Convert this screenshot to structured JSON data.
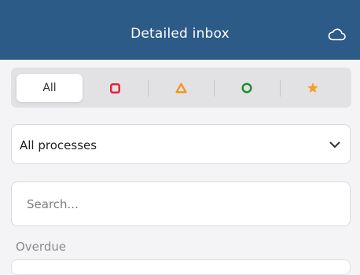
{
  "header": {
    "title": "Detailed inbox",
    "sync_icon": "cloud-icon"
  },
  "filters": {
    "segments": [
      {
        "label": "All",
        "icon": null,
        "selected": true
      },
      {
        "label": "",
        "icon": "red-square-icon",
        "color": "#e0263a",
        "selected": false
      },
      {
        "label": "",
        "icon": "orange-triangle-icon",
        "color": "#f0961e",
        "selected": false
      },
      {
        "label": "",
        "icon": "green-circle-icon",
        "color": "#238c32",
        "selected": false
      },
      {
        "label": "",
        "icon": "orange-star-icon",
        "color": "#f5a028",
        "selected": false
      }
    ]
  },
  "process_select": {
    "value": "All processes",
    "icon": "chevron-down-icon"
  },
  "search": {
    "placeholder": "Search...",
    "value": ""
  },
  "sections": [
    {
      "label": "Overdue"
    }
  ],
  "colors": {
    "header_bg": "#2c5b88",
    "page_bg": "#f4f4f6"
  }
}
